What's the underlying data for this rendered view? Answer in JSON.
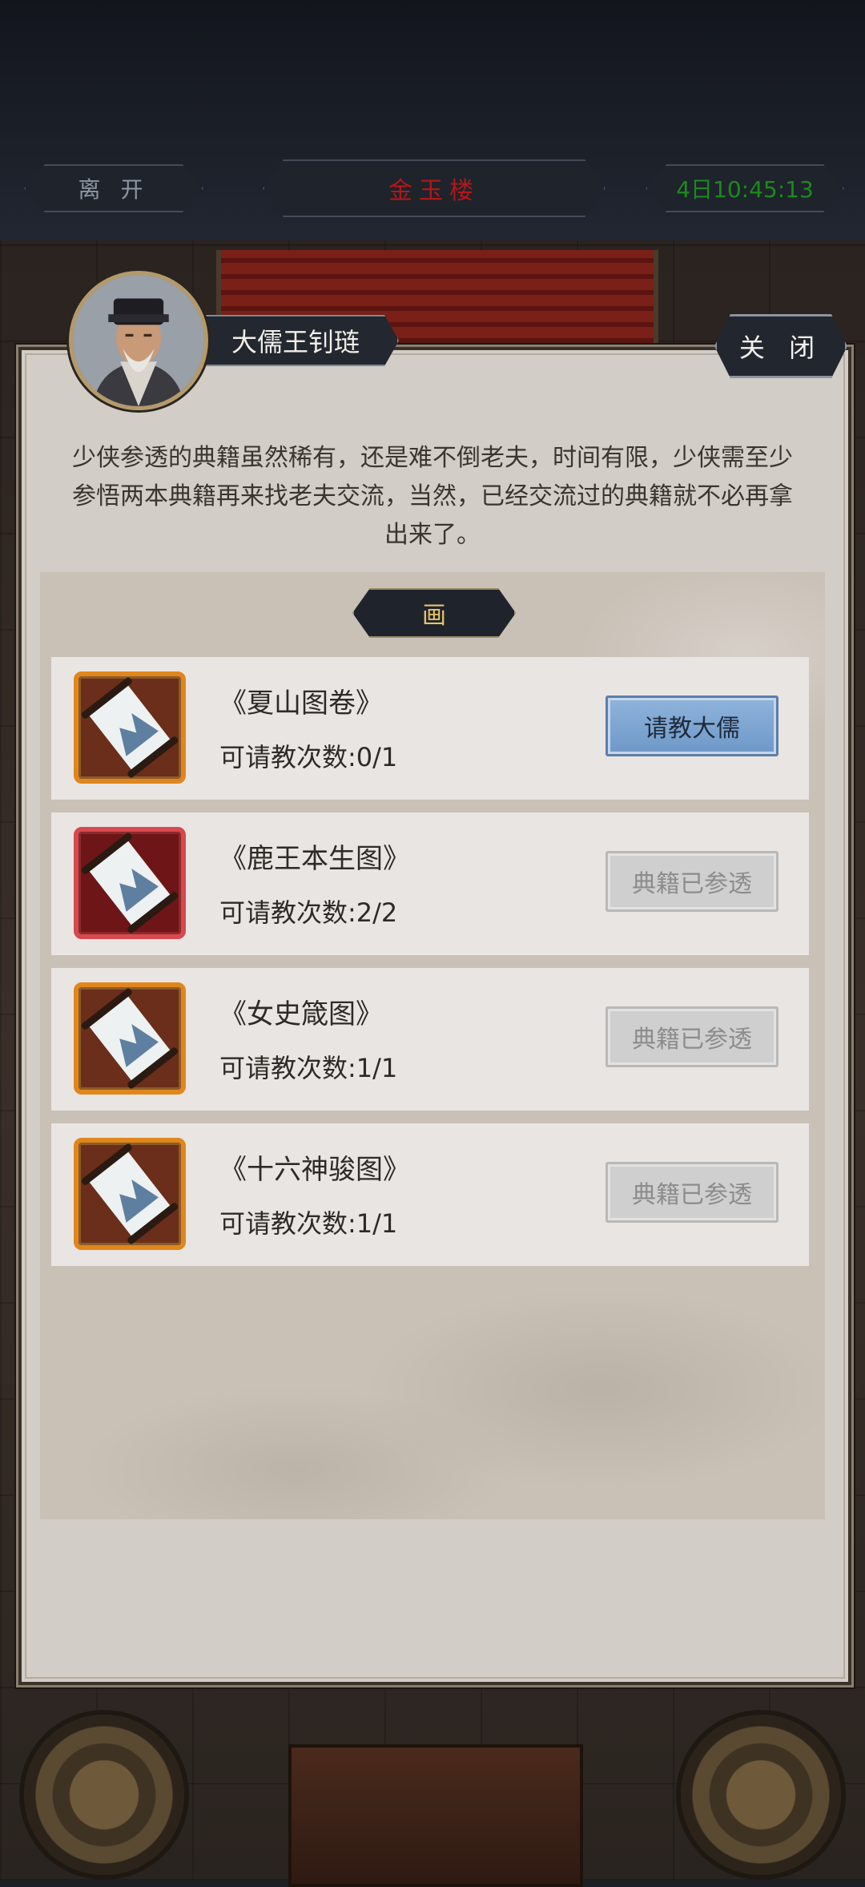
{
  "topbar": {
    "leave_label": "离 开",
    "location_title": "金玉楼",
    "clock": "4日10:45:13"
  },
  "npc": {
    "name": "大儒王钊琏",
    "avatar_icon": "scholar-portrait"
  },
  "dialog": {
    "close_label": "关 闭",
    "message": "少侠参透的典籍虽然稀有，还是难不倒老夫，时间有限，少侠需至少参悟两本典籍再来找老夫交流，当然，已经交流过的典籍就不必再拿出来了。",
    "category": "画"
  },
  "items": [
    {
      "title": "《夏山图卷》",
      "count": "可请教次数:0/1",
      "action": "请教大儒",
      "state": "active",
      "rarity_color": "#e0861c",
      "icon": "scroll-painting-icon"
    },
    {
      "title": "《鹿王本生图》",
      "count": "可请教次数:2/2",
      "action": "典籍已参透",
      "state": "done",
      "rarity_color": "#d7494f",
      "icon": "scroll-painting-icon"
    },
    {
      "title": "《女史箴图》",
      "count": "可请教次数:1/1",
      "action": "典籍已参透",
      "state": "done",
      "rarity_color": "#e0861c",
      "icon": "scroll-painting-icon"
    },
    {
      "title": "《十六神骏图》",
      "count": "可请教次数:1/1",
      "action": "典籍已参透",
      "state": "done",
      "rarity_color": "#e0861c",
      "icon": "scroll-painting-icon"
    }
  ]
}
